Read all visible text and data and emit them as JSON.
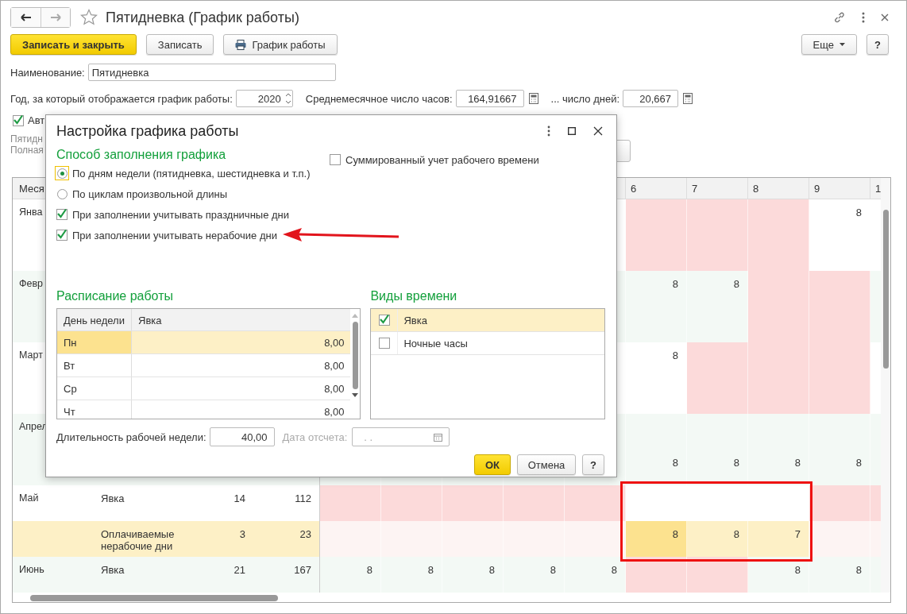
{
  "window": {
    "title": "Пятидневка (График работы)"
  },
  "toolbar": {
    "buttons": [
      {
        "label": "Записать и закрыть",
        "kind": "primary"
      },
      {
        "label": "Записать",
        "kind": "plain"
      },
      {
        "label": "График работы",
        "kind": "print"
      }
    ],
    "more": "Еще",
    "help": "?"
  },
  "name_field": {
    "label": "Наименование:",
    "value": "Пятидневка"
  },
  "year_row": {
    "label": "Год, за который отображается график работы:",
    "year": "2020",
    "hours_label": "Среднемесячное число часов:",
    "hours": "164,91667",
    "days_label": "... число дней:",
    "days": "20,667"
  },
  "auto_checkbox": {
    "label": "Авт",
    "checked": true
  },
  "info_lines": [
    "Пятидн",
    "Полная"
  ],
  "schedule_table": {
    "month_header": "Меся",
    "day_headers": [
      "6",
      "7",
      "8",
      "9",
      "1"
    ],
    "rows": [
      {
        "month": "Янва",
        "tall": true,
        "kind": "plain",
        "days": [
          {
            "off": true,
            "selected": false
          },
          {
            "off": true,
            "selected": false
          },
          {
            "off": true,
            "selected": false
          },
          {
            "value": "8",
            "off": false,
            "selected": false
          },
          {
            "off": false,
            "selected": false
          }
        ]
      },
      {
        "month": "Февр",
        "tall": true,
        "kind": "striped",
        "days": [
          {
            "value": "8",
            "off": false,
            "selected": false
          },
          {
            "value": "8",
            "off": false,
            "selected": false
          },
          {
            "off": true,
            "selected": false
          },
          {
            "off": true,
            "selected": false
          },
          {
            "off": false,
            "selected": false
          }
        ]
      },
      {
        "month": "Март",
        "tall": true,
        "kind": "plain",
        "days": [
          {
            "value": "8",
            "off": false,
            "selected": false
          },
          {
            "off": true,
            "selected": false
          },
          {
            "off": true,
            "selected": false
          },
          {
            "off": true,
            "selected": false
          },
          {
            "off": false,
            "selected": false
          }
        ]
      },
      {
        "month": "Апрел",
        "tall": false,
        "kind": "striped",
        "days": [
          {
            "off": false,
            "selected": false
          },
          {
            "off": false,
            "selected": false
          },
          {
            "off": false,
            "selected": false
          },
          {
            "off": false,
            "selected": false
          },
          {
            "off": false,
            "selected": false
          }
        ]
      },
      {
        "tall": false,
        "kind": "striped",
        "days": [
          {
            "value": "8",
            "off": false,
            "selected": false
          },
          {
            "value": "8",
            "off": false,
            "selected": false
          },
          {
            "value": "8",
            "off": false,
            "selected": false
          },
          {
            "value": "8",
            "off": false,
            "selected": false
          },
          {
            "off": false,
            "selected": false
          }
        ]
      },
      {
        "month": "Май",
        "type": "Явка",
        "count": "14",
        "hours": "112",
        "tall": false,
        "kind": "plain",
        "days": [
          {
            "off": true,
            "selected": false
          },
          {
            "off": true,
            "selected": false
          },
          {
            "off": true,
            "selected": false
          },
          {
            "off": true,
            "selected": false
          },
          {
            "off": true,
            "selected": false
          },
          {
            "off": false,
            "selected": false
          },
          {
            "off": false,
            "selected": false
          },
          {
            "off": false,
            "selected": false
          },
          {
            "off": true,
            "selected": false
          },
          {
            "off": true,
            "selected": false
          }
        ]
      },
      {
        "month": "",
        "type": "Оплачиваемые нерабочие дни",
        "count": "3",
        "hours": "23",
        "tall": false,
        "kind": "paid",
        "days": [
          {
            "off": true,
            "selected": false
          },
          {
            "off": true,
            "selected": false
          },
          {
            "off": true,
            "selected": false
          },
          {
            "off": true,
            "selected": false
          },
          {
            "off": true,
            "selected": false
          },
          {
            "value": "8",
            "off": false,
            "selected": true
          },
          {
            "value": "8",
            "off": false,
            "selected": false
          },
          {
            "value": "7",
            "off": false,
            "selected": false
          },
          {
            "off": true,
            "selected": false
          },
          {
            "off": true,
            "selected": false
          }
        ]
      },
      {
        "month": "Июнь",
        "type": "Явка",
        "count": "21",
        "hours": "167",
        "tall": false,
        "kind": "striped",
        "days": [
          {
            "value": "8",
            "off": false,
            "selected": false
          },
          {
            "value": "8",
            "off": false,
            "selected": false
          },
          {
            "value": "8",
            "off": false,
            "selected": false
          },
          {
            "value": "8",
            "off": false,
            "selected": false
          },
          {
            "value": "8",
            "off": false,
            "selected": false
          },
          {
            "off": true,
            "selected": false
          },
          {
            "off": true,
            "selected": false
          },
          {
            "value": "8",
            "off": false,
            "selected": false
          },
          {
            "value": "8",
            "off": false,
            "selected": false
          },
          {
            "off": false,
            "selected": false
          }
        ]
      }
    ]
  },
  "dialog": {
    "title": "Настройка графика работы",
    "fill_heading": "Способ заполнения графика",
    "options": [
      {
        "kind": "radio",
        "label": "По дням недели (пятидневка, шестидневка и т.п.)",
        "selected": true
      },
      {
        "kind": "radio",
        "label": "По циклам произвольной длины",
        "selected": false
      },
      {
        "kind": "checkbox",
        "label": "При заполнении учитывать праздничные дни",
        "checked": true
      },
      {
        "kind": "checkbox",
        "label": "При заполнении учитывать нерабочие дни",
        "checked": true
      }
    ],
    "summed": {
      "label": "Суммированный учет рабочего времени",
      "checked": false
    },
    "schedule_heading": "Расписание работы",
    "schedule_columns": [
      "День недели",
      "Явка"
    ],
    "schedule_rows": [
      {
        "day": "Пн",
        "hours": "8,00",
        "selected": true
      },
      {
        "day": "Вт",
        "hours": "8,00",
        "selected": false
      },
      {
        "day": "Ср",
        "hours": "8,00",
        "selected": false
      },
      {
        "day": "Чт",
        "hours": "8,00",
        "selected": false
      }
    ],
    "time_heading": "Виды времени",
    "time_kinds": [
      {
        "label": "Явка",
        "checked": true,
        "selected": true
      },
      {
        "label": "Ночные часы",
        "checked": false,
        "selected": false
      }
    ],
    "week_length": {
      "label": "Длительность рабочей недели:",
      "value": "40,00"
    },
    "start_date": {
      "label": "Дата отсчета:",
      "value": ". .",
      "disabled": true
    },
    "buttons": {
      "ok": "ОК",
      "cancel": "Отмена",
      "help": "?"
    }
  }
}
